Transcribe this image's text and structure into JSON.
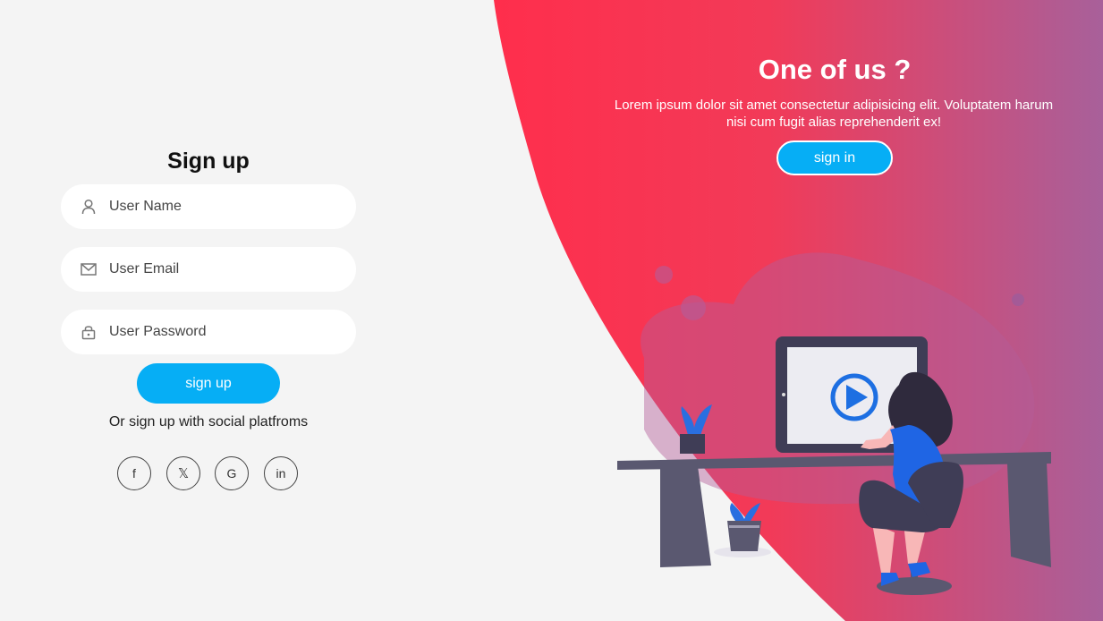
{
  "signup": {
    "title": "Sign up",
    "username_placeholder": "User Name",
    "email_placeholder": "User Email",
    "password_placeholder": "User Password",
    "submit_label": "sign up",
    "social_text": "Or sign up with social platfroms",
    "social": [
      {
        "label": "f",
        "icon": "facebook-icon"
      },
      {
        "label": "𝕏",
        "icon": "x-twitter-icon"
      },
      {
        "label": "G",
        "icon": "google-icon"
      },
      {
        "label": "in",
        "icon": "linkedin-icon"
      }
    ]
  },
  "panel": {
    "title": "One of us ?",
    "description": "Lorem ipsum dolor sit amet consectetur adipisicing elit. Voluptatem harum nisi cum fugit alias reprehenderit ex!",
    "signin_label": "sign in"
  },
  "colors": {
    "gradient_start": "#ff3550",
    "gradient_end": "#a8609a",
    "button": "#06aef5",
    "background": "#f4f4f4"
  }
}
